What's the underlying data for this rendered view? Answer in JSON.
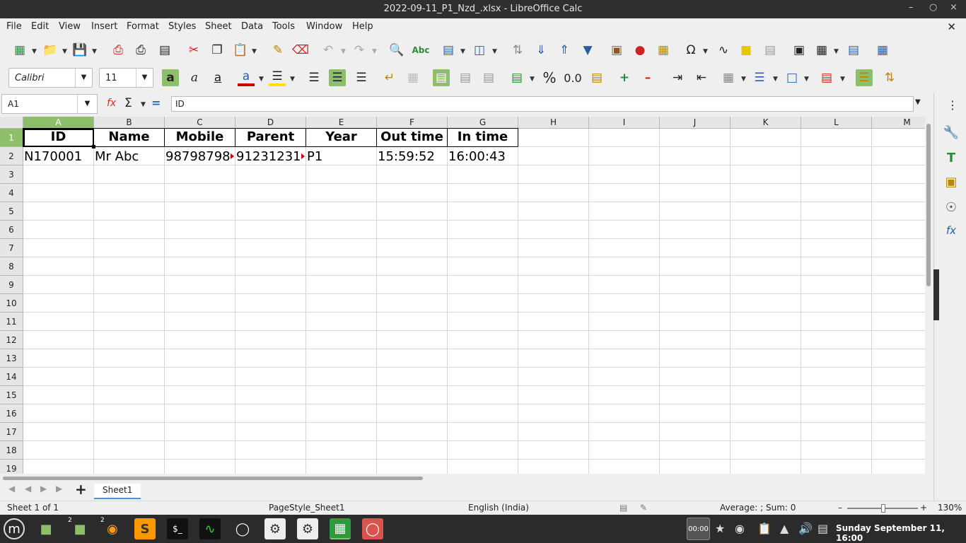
{
  "window": {
    "title": "2022-09-11_P1_Nzd_.xlsx - LibreOffice Calc"
  },
  "menu": [
    "File",
    "Edit",
    "View",
    "Insert",
    "Format",
    "Styles",
    "Sheet",
    "Data",
    "Tools",
    "Window",
    "Help"
  ],
  "font": {
    "name": "Calibri",
    "size": "11"
  },
  "formula_bar": {
    "cell_ref": "A1",
    "content": "ID"
  },
  "columns": [
    "A",
    "B",
    "C",
    "D",
    "E",
    "F",
    "G",
    "H",
    "I",
    "J",
    "K",
    "L",
    "M"
  ],
  "rows": [
    "1",
    "2",
    "3",
    "4",
    "5",
    "6",
    "7",
    "8",
    "9",
    "10",
    "11",
    "12",
    "13",
    "14",
    "15",
    "16",
    "17",
    "18",
    "19"
  ],
  "table": {
    "headers": [
      "ID",
      "Name",
      "Mobile",
      "Parent",
      "Year",
      "Out time",
      "In time"
    ],
    "row": [
      "N170001",
      "Mr Abc",
      "98798798",
      "91231231",
      "P1",
      "15:59:52",
      "16:00:43"
    ]
  },
  "sheet_tab": "Sheet1",
  "status": {
    "sheet": "Sheet 1 of 1",
    "page_style": "PageStyle_Sheet1",
    "language": "English (India)",
    "summary": "Average: ; Sum: 0",
    "zoom": "130%"
  },
  "taskbar": {
    "timer": "00:00",
    "badge_files": "2",
    "badge_firefox": "2",
    "clock": "Sunday September 11, 16:00"
  }
}
